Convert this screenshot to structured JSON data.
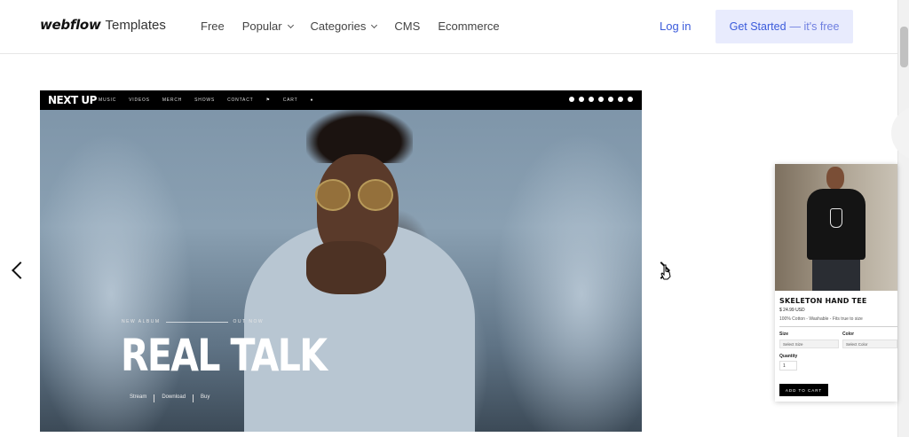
{
  "header": {
    "brand_word": "webflow",
    "brand_sub": "Templates",
    "nav": [
      "Free",
      "Popular",
      "Categories",
      "CMS",
      "Ecommerce"
    ],
    "login": "Log in",
    "cta_main": "Get Started",
    "cta_free": "— it's free",
    "accent_color": "#3b5bdb"
  },
  "slide": {
    "logo": "NEXT UP",
    "menu": [
      "MUSIC",
      "VIDEOS",
      "MERCH",
      "SHOWS",
      "CONTACT",
      "⚑",
      "CART",
      "●"
    ],
    "tag_left": "NEW ALBUM",
    "tag_right": "OUT NOW",
    "title": "REAL TALK",
    "links": [
      "Stream",
      "Download",
      "Buy"
    ]
  },
  "card": {
    "title": "SKELETON HAND TEE",
    "price": "$ 24.99 USD",
    "desc": "100% Cotton - Washable - Fits true to size",
    "size_label": "Size",
    "size_value": "Select Size",
    "color_label": "Color",
    "color_value": "Select Color",
    "qty_label": "Quantity",
    "qty_value": "1",
    "add_to_cart": "ADD TO CART"
  }
}
